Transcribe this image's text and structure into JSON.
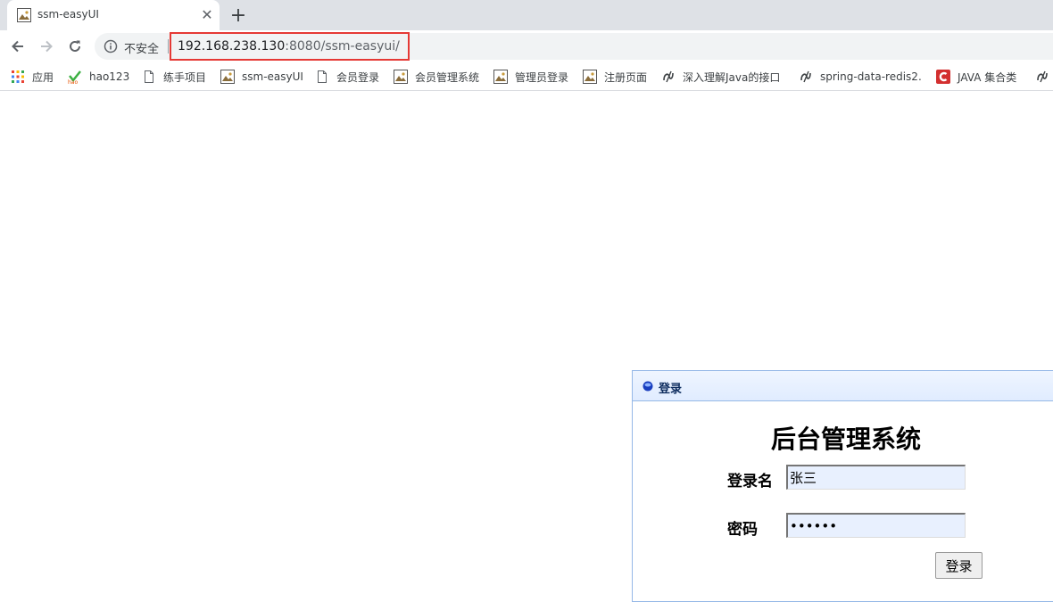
{
  "browser": {
    "tab": {
      "title": "ssm-easyUI",
      "close_symbol": "✕"
    },
    "new_tab_symbol": "+",
    "address": {
      "security_label": "不安全",
      "url_host": "192.168.238.130",
      "url_rest": ":8080/ssm-easyui/"
    },
    "bookmarks": [
      {
        "label": "应用",
        "icon": "apps-grid-icon"
      },
      {
        "label": "hao123",
        "icon": "hao123-icon"
      },
      {
        "label": "练手项目",
        "icon": "page-icon"
      },
      {
        "label": "ssm-easyUI",
        "icon": "image-favicon-icon"
      },
      {
        "label": "会员登录",
        "icon": "page-icon"
      },
      {
        "label": "会员管理系统",
        "icon": "image-favicon-icon"
      },
      {
        "label": "管理员登录",
        "icon": "image-favicon-icon"
      },
      {
        "label": "注册页面",
        "icon": "image-favicon-icon"
      },
      {
        "label": "深入理解Java的接口",
        "icon": "script-icon"
      },
      {
        "label": "spring-data-redis2.",
        "icon": "script-icon"
      },
      {
        "label": "JAVA 集合类",
        "icon": "csdn-icon"
      }
    ]
  },
  "login": {
    "panel_title": "登录",
    "system_title": "后台管理系统",
    "username_label": "登录名",
    "username_value": "张三",
    "password_label": "密码",
    "password_value": "••••••",
    "submit_label": "登录"
  }
}
